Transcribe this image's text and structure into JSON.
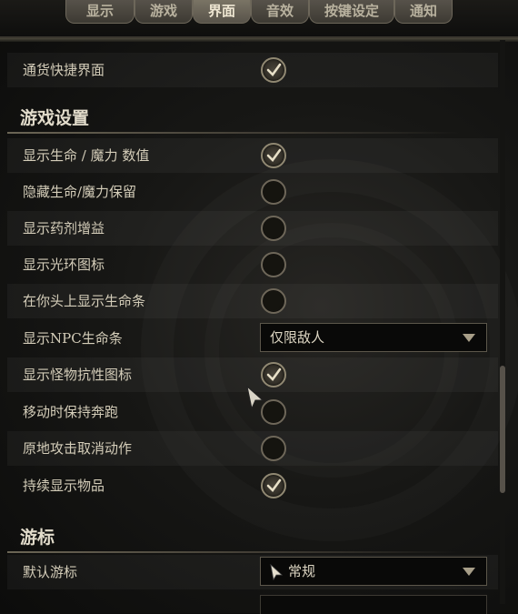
{
  "tabs": [
    {
      "label": "显示",
      "active": false
    },
    {
      "label": "游戏",
      "active": false
    },
    {
      "label": "界面",
      "active": true
    },
    {
      "label": "音效",
      "active": false
    },
    {
      "label": "按键设定",
      "active": false
    },
    {
      "label": "通知",
      "active": false
    }
  ],
  "top_option": {
    "label": "通货快捷界面",
    "checked": true
  },
  "sections": {
    "game_settings": {
      "title": "游戏设置",
      "options": [
        {
          "label": "显示生命 / 魔力 数值",
          "checked": true
        },
        {
          "label": "隐藏生命/魔力保留",
          "checked": false
        },
        {
          "label": "显示药剂增益",
          "checked": false
        },
        {
          "label": "显示光环图标",
          "checked": false
        },
        {
          "label": "在你头上显示生命条",
          "checked": false
        },
        {
          "label": "显示NPC生命条",
          "dropdown_value": "仅限敌人"
        },
        {
          "label": "显示怪物抗性图标",
          "checked": true
        },
        {
          "label": "移动时保持奔跑",
          "checked": false
        },
        {
          "label": "原地攻击取消动作",
          "checked": false
        },
        {
          "label": "持续显示物品",
          "checked": true
        }
      ]
    },
    "cursor": {
      "title": "游标",
      "options": [
        {
          "label": "默认游标",
          "dropdown_value": "常规",
          "icon": "cursor-arrow-icon"
        }
      ]
    }
  },
  "colors": {
    "accent": "#908872",
    "text": "#d4cdb9",
    "background": "#0d0d0c"
  }
}
